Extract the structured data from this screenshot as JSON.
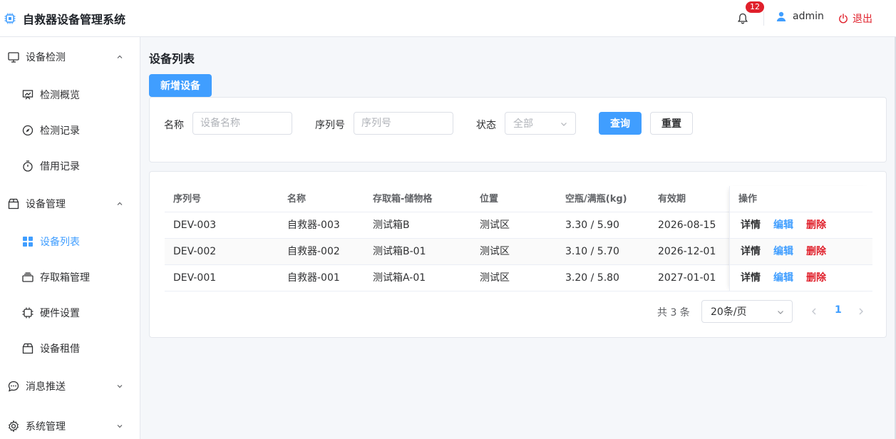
{
  "app": {
    "title": "自救器设备管理系统"
  },
  "header": {
    "notification_count": "12",
    "username": "admin",
    "logout_label": "退出"
  },
  "sidebar": {
    "groups": [
      {
        "label": "设备检测",
        "icon": "monitor-icon",
        "expanded": true,
        "items": [
          {
            "label": "检测概览",
            "icon": "presentation-chart-icon"
          },
          {
            "label": "检测记录",
            "icon": "compass-icon"
          },
          {
            "label": "借用记录",
            "icon": "stopwatch-icon"
          }
        ]
      },
      {
        "label": "设备管理",
        "icon": "box-icon",
        "expanded": true,
        "items": [
          {
            "label": "设备列表",
            "icon": "grid-icon",
            "active": true
          },
          {
            "label": "存取箱管理",
            "icon": "tray-icon"
          },
          {
            "label": "硬件设置",
            "icon": "chip-icon"
          },
          {
            "label": "设备租借",
            "icon": "box-icon"
          }
        ]
      },
      {
        "label": "消息推送",
        "icon": "chat-bubble-icon",
        "expanded": false,
        "items": []
      },
      {
        "label": "系统管理",
        "icon": "gear-icon",
        "expanded": false,
        "items": []
      }
    ]
  },
  "main": {
    "page_title": "设备列表",
    "add_button": "新增设备",
    "filters": {
      "name_label": "名称",
      "name_placeholder": "设备名称",
      "serial_label": "序列号",
      "serial_placeholder": "序列号",
      "status_label": "状态",
      "status_value": "全部",
      "query_button": "查询",
      "reset_button": "重置"
    },
    "table": {
      "columns": [
        "序列号",
        "名称",
        "存取箱-储物格",
        "位置",
        "空瓶/满瓶(kg)",
        "有效期",
        "操作"
      ],
      "rows": [
        {
          "serial": "DEV-003",
          "name": "自救器-003",
          "box": "测试箱B",
          "location": "测试区",
          "weight": "3.30 / 5.90",
          "expiry": "2026-08-15"
        },
        {
          "serial": "DEV-002",
          "name": "自救器-002",
          "box": "测试箱B-01",
          "location": "测试区",
          "weight": "3.10 / 5.70",
          "expiry": "2026-12-01"
        },
        {
          "serial": "DEV-001",
          "name": "自救器-001",
          "box": "测试箱A-01",
          "location": "测试区",
          "weight": "3.20 / 5.80",
          "expiry": "2027-01-01"
        }
      ],
      "actions": {
        "detail": "详情",
        "edit": "编辑",
        "delete": "删除"
      }
    },
    "pagination": {
      "total_text": "共 3 条",
      "page_size": "20条/页",
      "current_page": "1"
    }
  },
  "colors": {
    "primary": "#409eff",
    "danger": "#e0202b",
    "badge": "#e0202b"
  }
}
